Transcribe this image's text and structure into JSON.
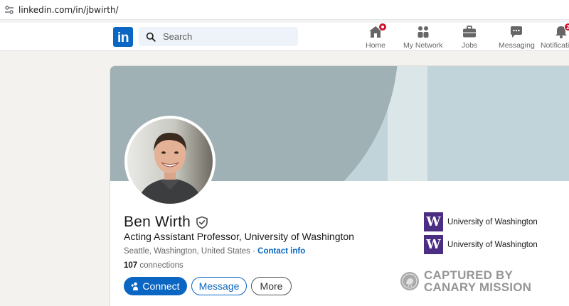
{
  "browser": {
    "url": "linkedin.com/in/jbwirth/"
  },
  "header": {
    "logo_text": "in",
    "search_placeholder": "Search",
    "nav": [
      {
        "label": "Home",
        "icon": "home-icon",
        "badge": "dot"
      },
      {
        "label": "My Network",
        "icon": "network-icon"
      },
      {
        "label": "Jobs",
        "icon": "briefcase-icon"
      },
      {
        "label": "Messaging",
        "icon": "messaging-icon"
      },
      {
        "label": "Notifications",
        "icon": "bell-icon",
        "badge": "2"
      }
    ]
  },
  "profile": {
    "name": "Ben Wirth",
    "headline": "Acting Assistant Professor, University of Washington",
    "location": "Seattle, Washington, United States",
    "location_separator": " · ",
    "contact_info": "Contact info",
    "connections_count": "107",
    "connections_label": " connections",
    "buttons": {
      "connect": "Connect",
      "message": "Message",
      "more": "More"
    },
    "education": [
      {
        "logo_letter": "W",
        "name": "University of Washington"
      },
      {
        "logo_letter": "W",
        "name": "University of Washington"
      }
    ]
  },
  "watermark": {
    "line1": "CAPTURED BY",
    "line2": "CANARY MISSION"
  },
  "colors": {
    "brand": "#0a66c2",
    "uw_purple": "#4b2e83",
    "badge_red": "#cb112d",
    "banner": "#9fb1b5"
  }
}
